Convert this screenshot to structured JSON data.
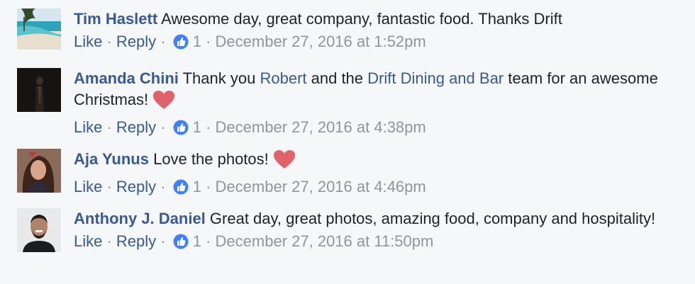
{
  "comments": [
    {
      "author": "Tim Haslett",
      "segments": [
        " Awesome day, great company, fantastic food. Thanks Drift"
      ],
      "like_label": "Like",
      "reply_label": "Reply",
      "reaction_count": "1",
      "timestamp": "December 27, 2016 at 1:52pm",
      "avatar_icon": "beach-avatar"
    },
    {
      "author": "Amanda Chini",
      "text_a": " Thank you ",
      "mention_1": "Robert",
      "text_b": " and the ",
      "mention_2": "Drift Dining and Bar",
      "text_c": " team for an awesome Christmas!",
      "like_label": "Like",
      "reply_label": "Reply",
      "reaction_count": "1",
      "timestamp": "December 27, 2016 at 4:38pm",
      "avatar_icon": "dark-portrait-avatar",
      "emoji": "heart-icon"
    },
    {
      "author": "Aja Yunus",
      "text": " Love the photos!",
      "like_label": "Like",
      "reply_label": "Reply",
      "reaction_count": "1",
      "timestamp": "December 27, 2016 at 4:46pm",
      "avatar_icon": "woman-portrait-avatar",
      "emoji": "heart-icon"
    },
    {
      "author": "Anthony J. Daniel",
      "text": " Great day, great photos, amazing food, company and hospitality!",
      "like_label": "Like",
      "reply_label": "Reply",
      "reaction_count": "1",
      "timestamp": "December 27, 2016 at 11:50pm",
      "avatar_icon": "man-portrait-avatar"
    }
  ],
  "separator": " · ",
  "colors": {
    "link": "#385898",
    "meta": "#90949c",
    "background": "#f6f7f9",
    "like_badge": "#4080ff",
    "heart": "#e0626b"
  }
}
